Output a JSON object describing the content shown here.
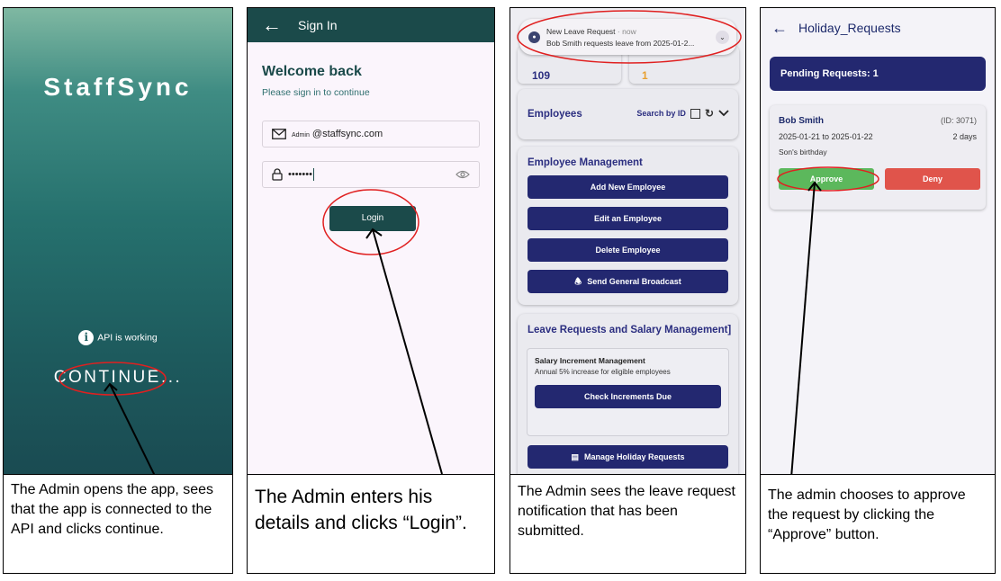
{
  "panels": [
    {
      "splash": {
        "app_title": "StaffSync",
        "api_icon": "info-icon",
        "api_status": "API is working",
        "continue_label": "CONTINUE..."
      },
      "caption": "The Admin opens the app, sees that the app is connected to the API and clicks continue."
    },
    {
      "appbar": {
        "back_icon": "arrow-left-icon",
        "title": "Sign In"
      },
      "welcome_title": "Welcome back",
      "welcome_subtitle": "Please sign in to continue",
      "email_field": {
        "prefix": "Admin",
        "value": "@staffsync.com",
        "icon": "mail-icon"
      },
      "password_field": {
        "value": "•••••••",
        "icon": "lock-icon",
        "toggle_icon": "eye-icon"
      },
      "login_label": "Login",
      "caption": "The Admin enters his details and clicks “Login”."
    },
    {
      "notification": {
        "title": "New Leave Request",
        "time": "· now",
        "body": "Bob Smith requests leave from 2025-01-2...",
        "icon": "bell-icon"
      },
      "stats": {
        "value_left": "109",
        "value_right": "1"
      },
      "employees": {
        "title": "Employees",
        "search_label": "Search by ID",
        "icons": [
          "checkbox-icon",
          "refresh-icon",
          "chevron-down-icon"
        ]
      },
      "employee_management": {
        "title": "Employee Management",
        "buttons": [
          "Add New Employee",
          "Edit an Employee",
          "Delete Employee",
          "Send General Broadcast"
        ]
      },
      "leave_salary": {
        "title": "Leave Requests and Salary Management]",
        "salary_title": "Salary Increment Management",
        "salary_desc": "Annual 5% increase for eligible employees",
        "check_label": "Check Increments Due",
        "manage_label": "Manage Holiday Requests"
      },
      "caption": "The Admin sees the leave request notification that has been submitted."
    },
    {
      "appbar": {
        "back_icon": "arrow-left-icon",
        "title": "Holiday_Requests"
      },
      "pending_label": "Pending Requests: 1",
      "request": {
        "name": "Bob Smith",
        "id": "(ID: 3071)",
        "dates": "2025-01-21 to 2025-01-22",
        "duration": "2 days",
        "reason": "Son's birthday",
        "approve_label": "Approve",
        "deny_label": "Deny"
      },
      "caption": "The admin chooses to approve the request by clicking the “Approve” button."
    }
  ],
  "colors": {
    "teal_dark": "#1b4a4a",
    "navy": "#232870",
    "approve_green": "#5cb85c",
    "deny_red": "#e0544b",
    "annotation_red": "#e02020"
  }
}
